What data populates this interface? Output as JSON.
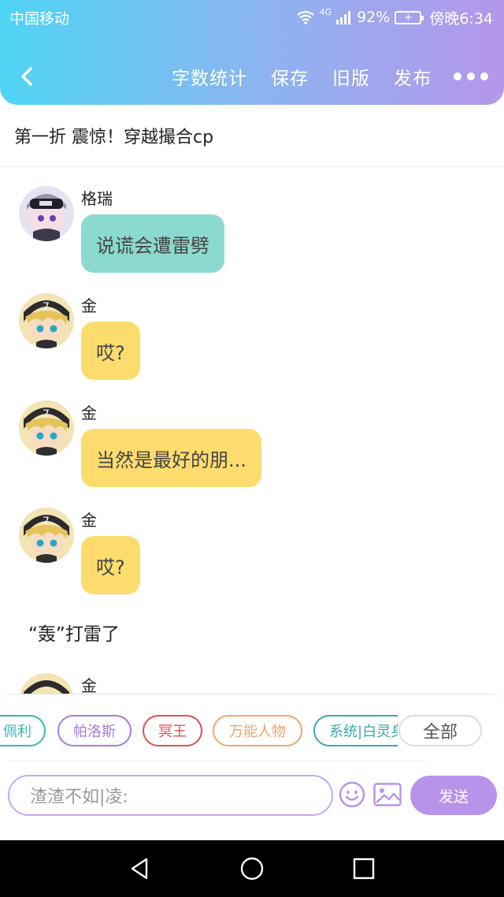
{
  "status_bar": {
    "carrier": "中国移动",
    "network": "4G",
    "battery_percent": "92%",
    "time": "傍晚6:34"
  },
  "header": {
    "back_icon": "chevron-left-icon",
    "actions": [
      "字数统计",
      "保存",
      "旧版",
      "发布"
    ],
    "more_icon": "more-dots-icon"
  },
  "chapter_title": "第一折 震惊！穿越撮合cp",
  "messages": [
    {
      "name": "格瑞",
      "text": "说谎会遭雷劈",
      "bubble_color": "#8cd9cf"
    },
    {
      "name": "金",
      "text": "哎?",
      "bubble_color": "#fddc6e"
    },
    {
      "name": "金",
      "text": "当然是最好的朋...",
      "bubble_color": "#fddc6e"
    },
    {
      "name": "金",
      "text": "哎?",
      "bubble_color": "#fddc6e"
    }
  ],
  "narration": "“轰”打雷了",
  "partial_message": {
    "name": "金"
  },
  "characters": [
    {
      "label": "佩利",
      "color": "#3ab6b6"
    },
    {
      "label": "帕洛斯",
      "color": "#a77bdc"
    },
    {
      "label": "冥王",
      "color": "#e05050"
    },
    {
      "label": "万能人物",
      "color": "#f0a46e"
    },
    {
      "label": "系统|白灵身",
      "color": "#3aa9a9"
    }
  ],
  "all_button": "全部",
  "input": {
    "placeholder": "渣渣不如|凌:"
  },
  "send_button": "发送",
  "colors": {
    "accent": "#b794ea",
    "gradient_start": "#4fd4f4",
    "gradient_end": "#b596ea"
  }
}
